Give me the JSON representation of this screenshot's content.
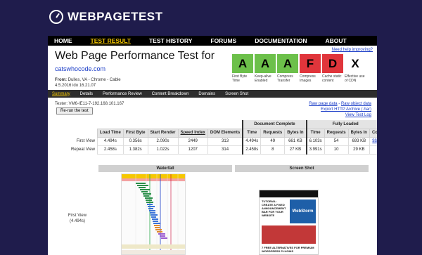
{
  "logo": {
    "bold": "WEB",
    "rest": "PAGETEST"
  },
  "nav": [
    {
      "label": "HOME",
      "active": false
    },
    {
      "label": "TEST RESULT",
      "active": true
    },
    {
      "label": "TEST HISTORY",
      "active": false
    },
    {
      "label": "FORUMS",
      "active": false
    },
    {
      "label": "DOCUMENTATION",
      "active": false
    },
    {
      "label": "ABOUT",
      "active": false
    }
  ],
  "header": {
    "title": "Web Page Performance Test for",
    "site": "catswhocode.com",
    "from_label": "From:",
    "from_value": "Dulles, VA - Chrome - Cable",
    "date": "4.5.2016 ido 16.21.07",
    "help_link": "Need help improving?"
  },
  "grades": [
    {
      "grade": "A",
      "label": "First Byte Time",
      "color": "#6cc04a"
    },
    {
      "grade": "A",
      "label": "Keep-alive Enabled",
      "color": "#6cc04a"
    },
    {
      "grade": "A",
      "label": "Compress Transfer",
      "color": "#6cc04a"
    },
    {
      "grade": "F",
      "label": "Compress Images",
      "color": "#e0353b"
    },
    {
      "grade": "D",
      "label": "Cache static content",
      "color": "#e0353b"
    },
    {
      "grade": "X",
      "label": "Effective use of CDN",
      "color": "#ffffff"
    }
  ],
  "subnav": [
    {
      "label": "Summary",
      "active": true
    },
    {
      "label": "Details",
      "active": false
    },
    {
      "label": "Performance Review",
      "active": false
    },
    {
      "label": "Content Breakdown",
      "active": false
    },
    {
      "label": "Domains",
      "active": false
    },
    {
      "label": "Screen Shot",
      "active": false
    }
  ],
  "tester": "Tester: VM6-IE11-7-192.168.101.167",
  "rerun": "Re-run the test",
  "raw_links": {
    "line1a": "Raw page data",
    "line1sep": " - ",
    "line1b": "Raw object data",
    "line2": "Export HTTP Archive (.har)",
    "line3": "View Test Log"
  },
  "table": {
    "group_doc": "Document Complete",
    "group_full": "Fully Loaded",
    "columns": [
      "Load Time",
      "First Byte",
      "Start Render",
      "Speed Index",
      "DOM Elements",
      "Time",
      "Requests",
      "Bytes In",
      "Time",
      "Requests",
      "Bytes In",
      "Cost"
    ],
    "rows": [
      {
        "label": "First View",
        "cells": [
          "4.494s",
          "0.356s",
          "2.090s",
          "2449",
          "313",
          "4.494s",
          "49",
          "661 KB",
          "6.103s",
          "54",
          "693 KB",
          "$$---"
        ]
      },
      {
        "label": "Repeat View",
        "cells": [
          "2.458s",
          "1.382s",
          "1.022s",
          "1207",
          "314",
          "2.458s",
          "8",
          "27 KB",
          "3.991s",
          "10",
          "29 KB",
          ""
        ]
      }
    ]
  },
  "media": {
    "waterfall_header": "Waterfall",
    "screenshot_header": "Screen Shot",
    "first_view_label": "First View",
    "first_view_time": "(4.494s)"
  },
  "screenshot_page": {
    "headline": "TUTORIAL: CREATE A FIXED ANNOUNCEMENT BAR FOR YOUR WEBSITE",
    "ad": "WebStorm",
    "footer": "7 FREE ALTERNATIVES FOR PREMIUM WORDPRESS PLUGINS"
  }
}
